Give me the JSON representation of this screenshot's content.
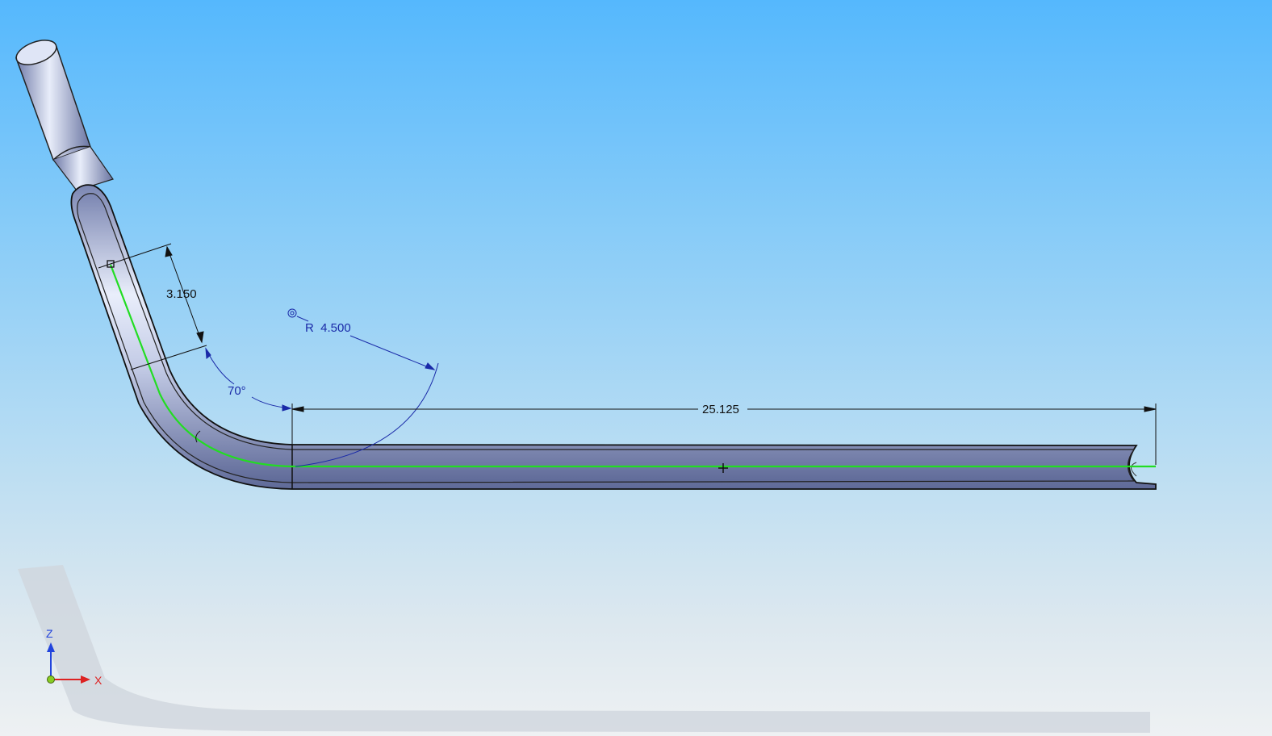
{
  "viewport": {
    "background_top": "#55b8fd",
    "background_bottom": "#eef1f3"
  },
  "part": {
    "tube_color": "#c9d2ec",
    "centerline_color": "#22dd22",
    "edge_color": "#111111"
  },
  "dimensions": {
    "straight_length": "3.150",
    "bend_angle": "70°",
    "bend_radius": "R  4.500",
    "tail_length": "25.125",
    "linear_color": "#111111",
    "angular_color": "#1a2aa8"
  },
  "triad": {
    "z_label": "Z",
    "x_label": "X",
    "z_color": "#2244dd",
    "x_color": "#dd2222",
    "origin_color": "#88cc22"
  }
}
